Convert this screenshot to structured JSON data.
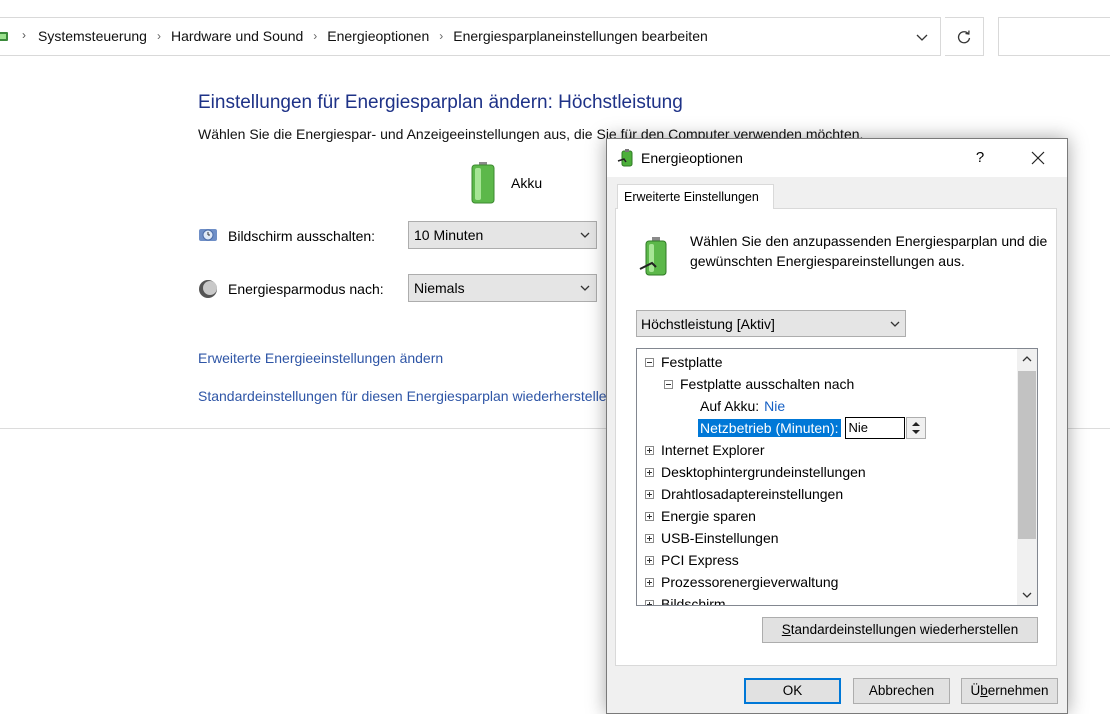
{
  "address_bar": {
    "breadcrumbs": [
      "Systemsteuerung",
      "Hardware und Sound",
      "Energieoptionen",
      "Energiesparplaneinstellungen bearbeiten"
    ]
  },
  "page": {
    "title": "Einstellungen für Energiesparplan ändern: Höchstleistung",
    "subtitle": "Wählen Sie die Energiespar- und Anzeigeeinstellungen aus, die Sie für den Computer verwenden möchten.",
    "battery_label": "Akku",
    "display_off_label": "Bildschirm ausschalten:",
    "display_off_value": "10 Minuten",
    "sleep_label": "Energiesparmodus nach:",
    "sleep_value": "Niemals",
    "link_advanced": "Erweiterte Energieeinstellungen ändern",
    "link_restore": "Standardeinstellungen für diesen Energiesparplan wiederherstellen"
  },
  "dialog": {
    "title": "Energieoptionen",
    "help_label": "?",
    "tab_label": "Erweiterte Einstellungen",
    "intro_text": "Wählen Sie den anzupassenden Energiesparplan und die gewünschten Energiespareinstellungen aus.",
    "plan_selected": "Höchstleistung [Aktiv]",
    "tree": {
      "festplatte": "Festplatte",
      "festplatte_ausschalten": "Festplatte ausschalten nach",
      "auf_akku_label": "Auf Akku:",
      "auf_akku_value": "Nie",
      "netzbetrieb_label": "Netzbetrieb (Minuten):",
      "netzbetrieb_value": "Nie",
      "items": [
        "Internet Explorer",
        "Desktophintergrundeinstellungen",
        "Drahtlosadaptereinstellungen",
        "Energie sparen",
        "USB-Einstellungen",
        "PCI Express",
        "Prozessorenergieverwaltung",
        "Bildschirm"
      ]
    },
    "restore_button": {
      "pre": "",
      "u": "S",
      "post": "tandardeinstellungen wiederherstellen"
    },
    "ok_button": "OK",
    "cancel_button": "Abbrechen",
    "apply_button": {
      "pre": "Ü",
      "u": "b",
      "post": "ernehmen"
    }
  },
  "colors": {
    "title_blue": "#1e3287",
    "link_blue": "#2e55a6",
    "selection": "#0078d7",
    "battery_green": "#4caf3a"
  }
}
